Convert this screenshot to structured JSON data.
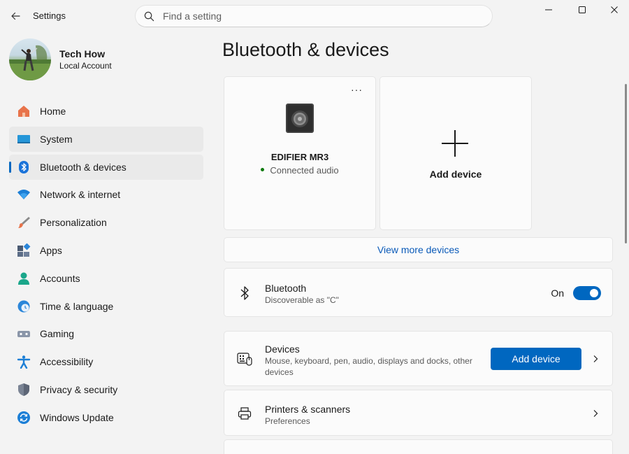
{
  "window": {
    "app_title": "Settings",
    "minimize_label": "",
    "maximize_label": "",
    "close_label": ""
  },
  "search": {
    "placeholder": "Find a setting",
    "value": ""
  },
  "profile": {
    "name": "Tech How",
    "account_type": "Local Account"
  },
  "sidebar": {
    "items": [
      {
        "label": "Home",
        "icon": "home-icon"
      },
      {
        "label": "System",
        "icon": "system-icon"
      },
      {
        "label": "Bluetooth & devices",
        "icon": "bluetooth-icon",
        "selected": true
      },
      {
        "label": "Network & internet",
        "icon": "wifi-icon"
      },
      {
        "label": "Personalization",
        "icon": "brush-icon"
      },
      {
        "label": "Apps",
        "icon": "apps-icon"
      },
      {
        "label": "Accounts",
        "icon": "person-icon"
      },
      {
        "label": "Time & language",
        "icon": "globe-clock-icon"
      },
      {
        "label": "Gaming",
        "icon": "gamepad-icon"
      },
      {
        "label": "Accessibility",
        "icon": "accessibility-icon"
      },
      {
        "label": "Privacy & security",
        "icon": "shield-icon"
      },
      {
        "label": "Windows Update",
        "icon": "update-icon"
      }
    ]
  },
  "main": {
    "title": "Bluetooth & devices",
    "device_card": {
      "more_label": "···",
      "name": "EDIFIER MR3",
      "status": "Connected audio",
      "status_color": "#0f7b0f"
    },
    "add_card": {
      "label": "Add device"
    },
    "view_more": "View more devices",
    "bluetooth": {
      "title": "Bluetooth",
      "subtitle": "Discoverable as \"C\"",
      "state_label": "On",
      "enabled": true
    },
    "devices": {
      "title": "Devices",
      "subtitle": "Mouse, keyboard, pen, audio, displays and docks, other devices",
      "button_label": "Add device"
    },
    "printers": {
      "title": "Printers & scanners",
      "subtitle": "Preferences"
    }
  },
  "colors": {
    "accent": "#0067c0",
    "link": "#0a5ab8",
    "background": "#f3f3f3",
    "card": "#fbfbfb"
  }
}
